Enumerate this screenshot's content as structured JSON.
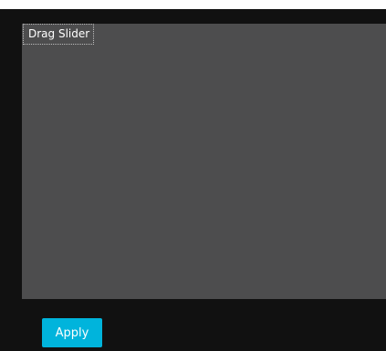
{
  "preview": {
    "drag_slider_label": "Drag Slider"
  },
  "actions": {
    "apply_label": "Apply"
  },
  "colors": {
    "background": "#111111",
    "preview_area": "#4d4d4e",
    "accent": "#00b4dc"
  }
}
